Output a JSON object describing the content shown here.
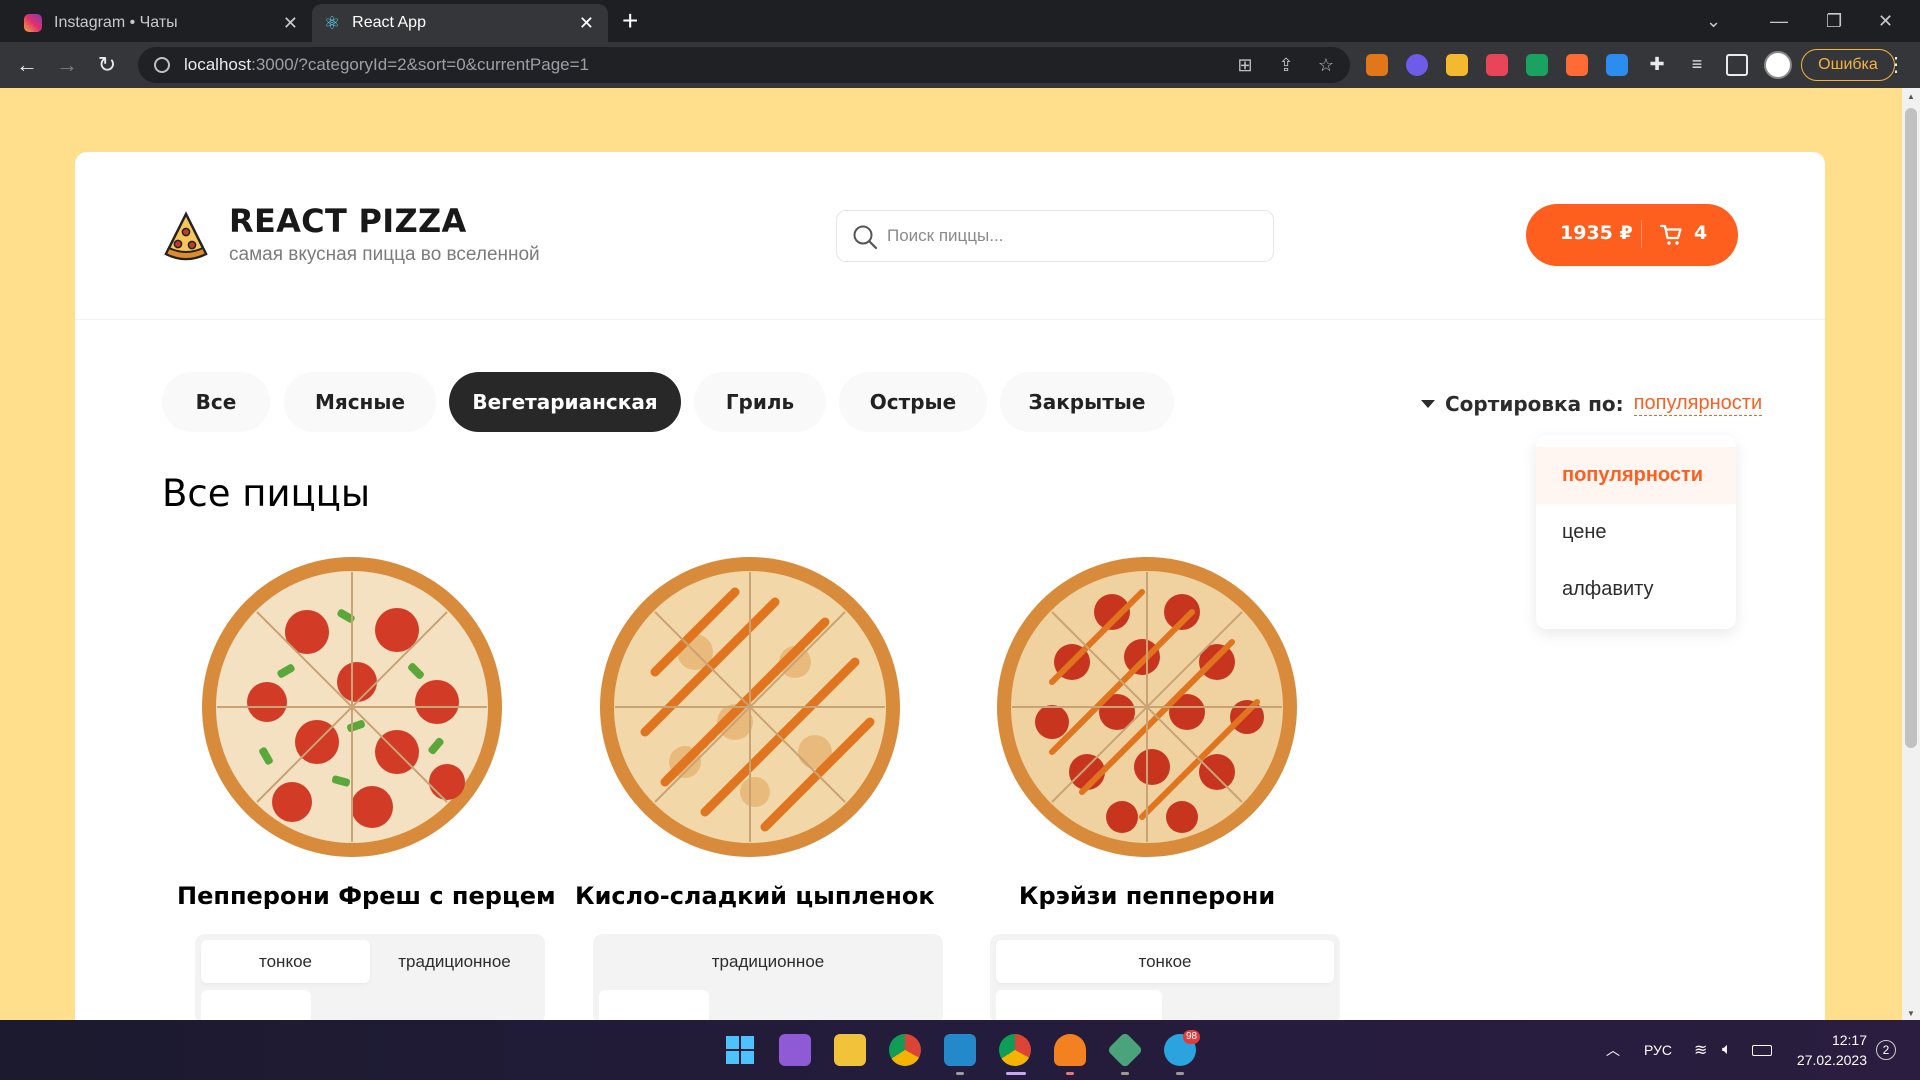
{
  "browser": {
    "tabs": [
      {
        "title": "Instagram • Чаты",
        "icon": "instagram-icon",
        "active": false
      },
      {
        "title": "React App",
        "icon": "react-icon",
        "active": true
      }
    ],
    "url_host": "localhost",
    "url_rest": ":3000/?categoryId=2&sort=0&currentPage=1",
    "error_label": "Ошибка"
  },
  "header": {
    "brand_title": "REACT PIZZA",
    "brand_subtitle": "самая вкусная пицца во вселенной",
    "search_placeholder": "Поиск пиццы...",
    "cart_price": "1935 ₽",
    "cart_count": "4"
  },
  "categories": [
    "Все",
    "Мясные",
    "Вегетарианская",
    "Гриль",
    "Острые",
    "Закрытые"
  ],
  "active_category": "Вегетарианская",
  "sort": {
    "label": "Сортировка по:",
    "selected": "популярности",
    "options": [
      "популярности",
      "цене",
      "алфавиту"
    ]
  },
  "section_title": "Все пиццы",
  "pizzas": [
    {
      "name": "Пепперони Фреш с перцем",
      "types": [
        "тонкое",
        "традиционное"
      ],
      "selected_type": "тонкое"
    },
    {
      "name": "Кисло-сладкий цыпленок",
      "types": [
        "традиционное"
      ],
      "selected_type": ""
    },
    {
      "name": "Крэйзи пепперони",
      "types": [
        "тонкое"
      ],
      "selected_type": "тонкое"
    }
  ],
  "taskbar": {
    "language": "РУС",
    "time": "12:17",
    "date": "27.02.2023",
    "notifications": "2",
    "telegram_badge": "98"
  },
  "colors": {
    "accent": "#fe5f1e",
    "page_bg": "#ffdf8c",
    "dark": "#282828"
  }
}
